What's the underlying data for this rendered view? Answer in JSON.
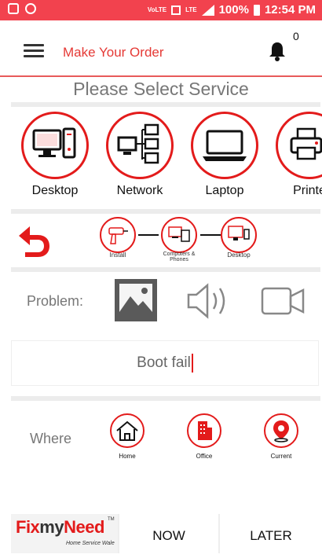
{
  "status_bar": {
    "network_label": "VoLTE",
    "lte_label": "LTE",
    "battery": "100%",
    "time": "12:54 PM"
  },
  "app_bar": {
    "title": "Make Your Order",
    "notification_count": "0"
  },
  "section_title": "Please Select Service",
  "services": [
    {
      "label": "Desktop",
      "icon": "desktop-icon"
    },
    {
      "label": "Network",
      "icon": "network-icon"
    },
    {
      "label": "Laptop",
      "icon": "laptop-icon"
    },
    {
      "label": "Printe",
      "icon": "printer-icon"
    }
  ],
  "steps": [
    {
      "label": "Install",
      "icon": "drill-icon"
    },
    {
      "label": "Computers & Phones",
      "icon": "devices-icon"
    },
    {
      "label": "Desktop",
      "icon": "desktop-phone-icon"
    }
  ],
  "problem": {
    "label": "Problem:",
    "attachments": [
      "image-icon",
      "audio-icon",
      "video-icon"
    ],
    "input_value": "Boot fail"
  },
  "where": {
    "label": "Where",
    "options": [
      {
        "label": "Home",
        "icon": "home-icon"
      },
      {
        "label": "Office",
        "icon": "office-building-icon"
      },
      {
        "label": "Current",
        "icon": "location-pin-icon"
      }
    ]
  },
  "bottom_bar": {
    "logo_fix": "Fix",
    "logo_my": "my",
    "logo_need": "Need",
    "logo_tagline": "Home Service Wale",
    "logo_tm": "TM",
    "now_label": "NOW",
    "later_label": "LATER"
  },
  "colors": {
    "accent": "#e31b1b",
    "status_bar": "#f2424e",
    "muted_text": "#777777"
  }
}
